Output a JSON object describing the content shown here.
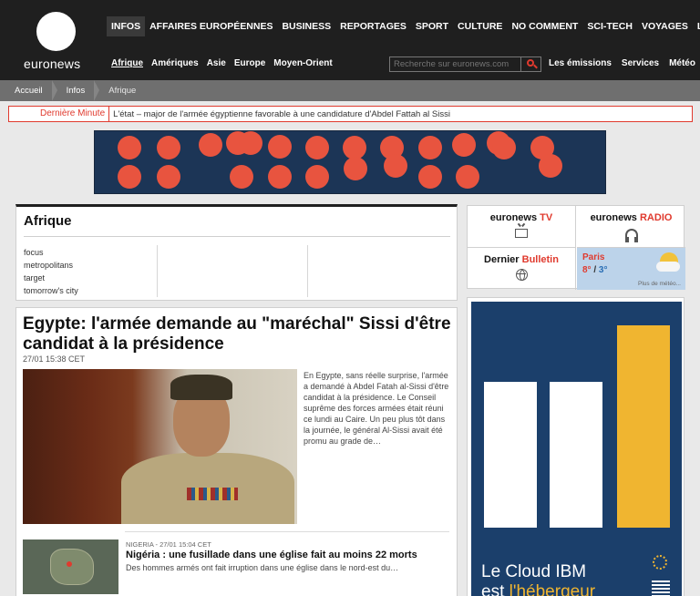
{
  "brand": {
    "logo_text": "euronews"
  },
  "topnav": [
    "INFOS",
    "AFFAIRES EUROPÉENNES",
    "BUSINESS",
    "REPORTAGES",
    "SPORT",
    "CULTURE",
    "NO COMMENT",
    "SCI-TECH",
    "VOYAGES",
    "LUXE"
  ],
  "subnav": [
    "Afrique",
    "Amériques",
    "Asie",
    "Europe",
    "Moyen-Orient"
  ],
  "search": {
    "placeholder": "Recherche sur euronews.com"
  },
  "rightnav": [
    "Les émissions",
    "Services",
    "Météo"
  ],
  "breadcrumb": [
    "Accueil",
    "Infos",
    "Afrique"
  ],
  "breaking": {
    "label": "Dernière Minute",
    "text": "L'état – major de l'armée égyptienne favorable à une candidature d'Abdel Fattah al Sissi"
  },
  "region": {
    "title": "Afrique",
    "links": [
      "focus",
      "metropolitans",
      "target",
      "tomorrow's city"
    ]
  },
  "main_article": {
    "headline": "Egypte: l'armée demande au \"maréchal\" Sissi d'être candidat à la présidence",
    "time": "27/01 15:38 CET",
    "summary": "En Egypte, sans réelle surprise, l'armée a demandé à Abdel Fatah al-Sissi d'être candidat à la présidence. Le Conseil suprême des forces armées était réuni ce lundi au Caire. Un peu plus tôt dans la journée, le général Al-Sissi avait été promu au grade de…"
  },
  "secondary_article": {
    "meta": "NIGERIA - 27/01 15:04 CET",
    "title": "Nigéria : une fusillade dans une église fait au moins 22 morts",
    "summary": "Des hommes armés ont fait irruption dans une église dans le nord-est du…"
  },
  "media": {
    "tv": {
      "brand": "euronews",
      "accent": "TV",
      "icon": "tv-icon"
    },
    "radio": {
      "brand": "euronews",
      "accent": "RADIO",
      "icon": "headphones-icon"
    },
    "bulletin": {
      "label": "Dernier",
      "accent": "Bulletin",
      "icon": "globe-icon"
    },
    "weather": {
      "city": "Paris",
      "max": "8°",
      "sep": " / ",
      "min": "3°",
      "more": "Plus de météo..."
    }
  },
  "ad": {
    "line1": "Le Cloud IBM",
    "line2_prefix": "est ",
    "line2_accent": "l'hébergeur"
  },
  "colors": {
    "accent": "#e03a2e",
    "header": "#1f1f1f",
    "ad_background": "#1b3f6b",
    "banner_background": "#1c3556"
  }
}
